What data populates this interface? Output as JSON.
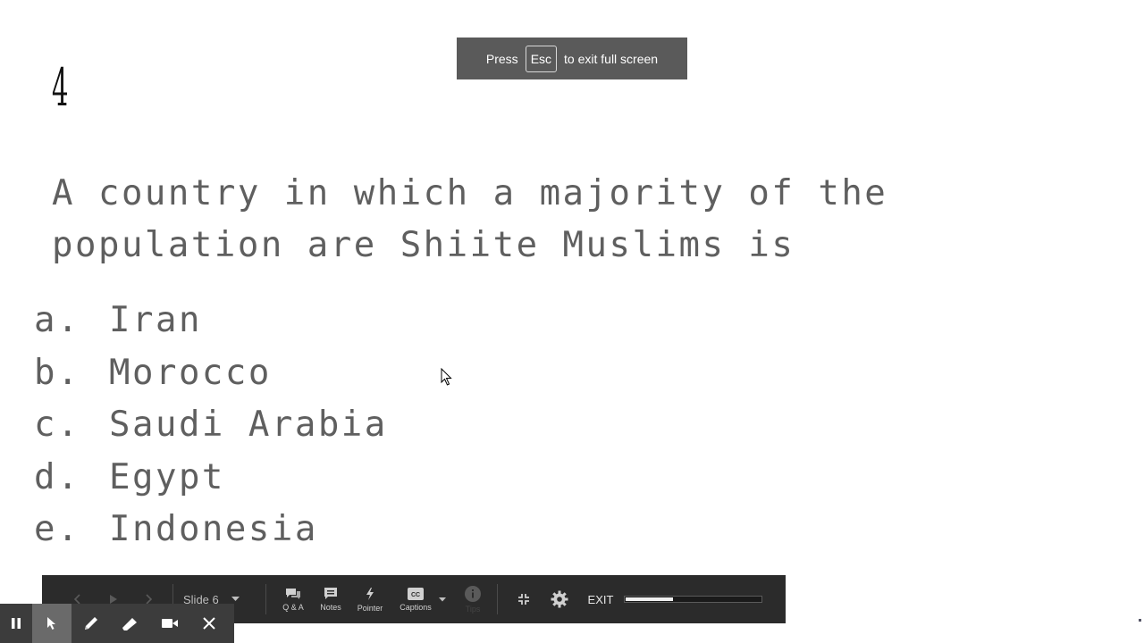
{
  "slide": {
    "number": "4",
    "question_line1": "A country in which a majority of the",
    "question_line2": "population are Shiite Muslims is",
    "answers": [
      {
        "letter": "a.",
        "text": "Iran"
      },
      {
        "letter": "b.",
        "text": "Morocco"
      },
      {
        "letter": "c.",
        "text": "Saudi Arabia"
      },
      {
        "letter": "d.",
        "text": "Egypt"
      },
      {
        "letter": "e.",
        "text": "Indonesia"
      }
    ]
  },
  "fullscreen_toast": {
    "press": "Press",
    "key": "Esc",
    "rest": "to exit full screen"
  },
  "toolbar": {
    "slide_selector": "Slide 6",
    "qa_label": "Q & A",
    "notes_label": "Notes",
    "pointer_label": "Pointer",
    "captions_label": "Captions",
    "captions_icon_text": "CC",
    "tips_label": "Tips",
    "exit_label": "EXIT",
    "progress": 0.35
  },
  "annotation_bar": {
    "tools": [
      "pause-icon",
      "select-arrow-icon",
      "pen-icon",
      "highlighter-icon",
      "video-camera-icon",
      "close-icon"
    ],
    "active_tool": "select-arrow-icon"
  }
}
